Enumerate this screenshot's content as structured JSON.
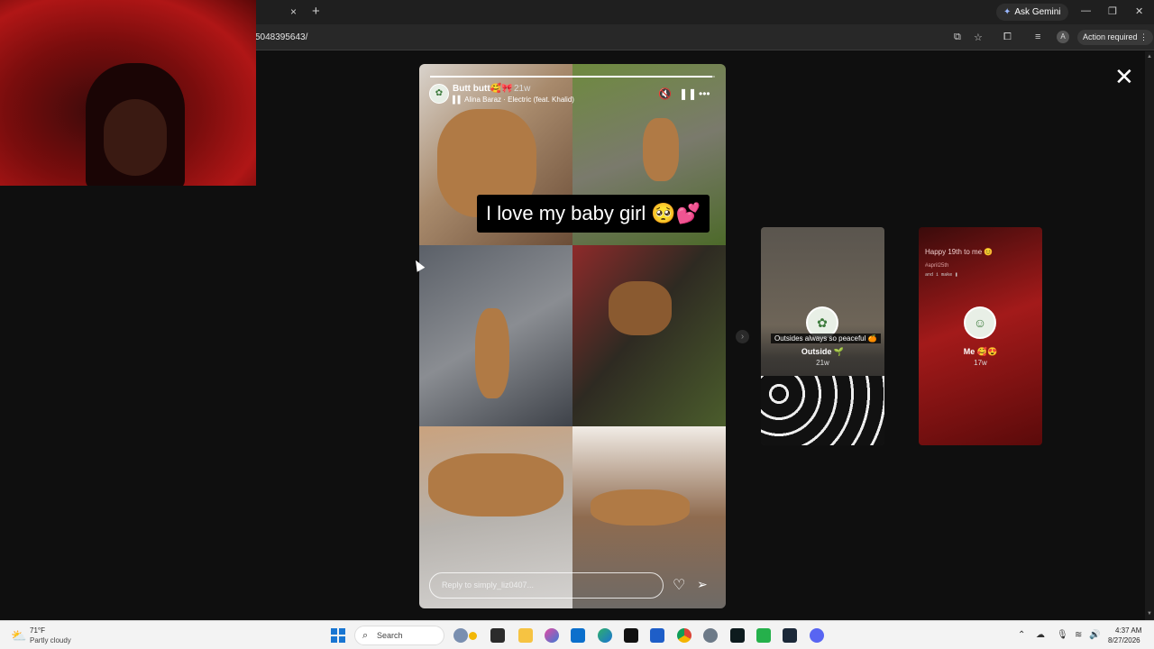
{
  "browser": {
    "tab_close": "×",
    "new_tab": "+",
    "gemini_label": "Ask Gemini",
    "window_controls": {
      "minimize": "—",
      "restore": "❐",
      "close": "✕"
    },
    "url": "5048395643/",
    "action_required": "Action required",
    "profile_initial": "A"
  },
  "viewer": {
    "close_label": "✕",
    "story": {
      "username": "Butt butt🥰🎀",
      "time": "21w",
      "music": "Alina Baraz · Electric (feat. Khalid)",
      "caption": "I love my baby girl 🥺💕",
      "progress": 0.99,
      "reply_placeholder": "Reply to simply_liz0407..."
    },
    "next_arrow": "›",
    "previews": [
      {
        "overlay_text": "Outsides always so peaceful 🍊",
        "title": "Outside 🌱",
        "time": "21w"
      },
      {
        "overlay_text": "Happy 19th to me 😊",
        "tag": "#april25th",
        "line": "and i make ❚",
        "title": "Me 🥰😍",
        "time": "17w"
      }
    ]
  },
  "taskbar": {
    "temperature": "71°F",
    "weather": "Partly cloudy",
    "search_label": "Search",
    "time": "4:37 AM",
    "date": "8/27/2026"
  }
}
